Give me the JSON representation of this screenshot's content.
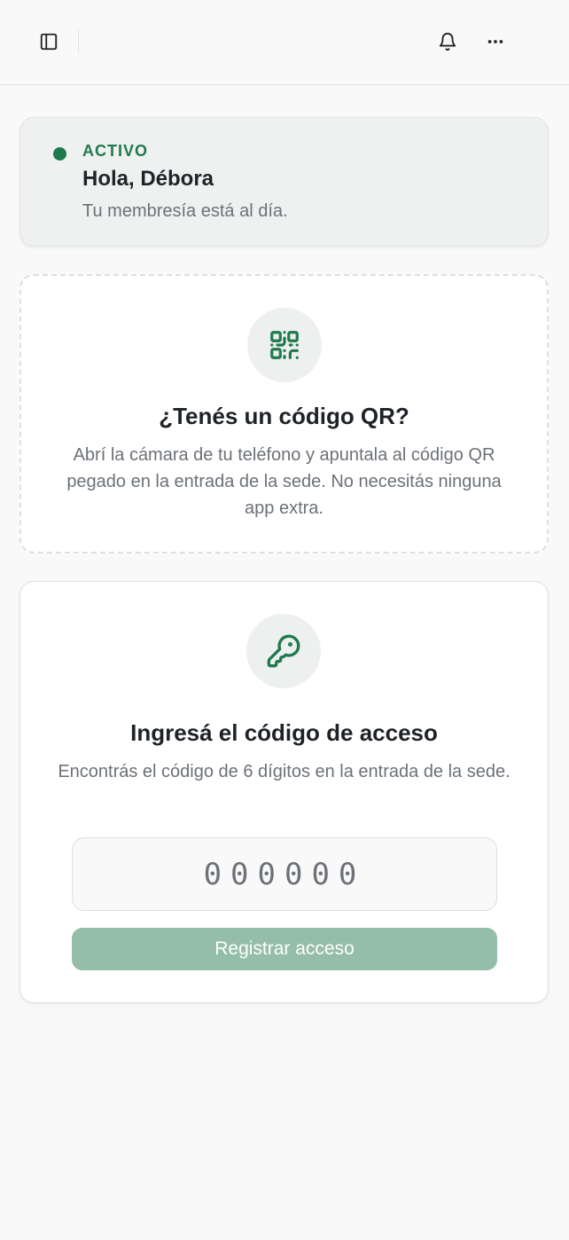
{
  "header": {
    "sidebar_icon": "sidebar-toggle-icon",
    "bell_icon": "bell-icon",
    "more_icon": "more-horizontal-icon"
  },
  "status": {
    "label": "ACTIVO",
    "greeting": "Hola, Débora",
    "description": "Tu membresía está al día.",
    "color": "#1e7a4c"
  },
  "qr": {
    "icon": "qr-code-icon",
    "title": "¿Tenés un código QR?",
    "description": "Abrí la cámara de tu teléfono y apuntala al código QR pegado en la entrada de la sede. No necesitás ninguna app extra."
  },
  "access_code": {
    "icon": "key-icon",
    "title": "Ingresá el código de acceso",
    "description": "Encontrás el código de 6 dígitos en la entrada de la sede.",
    "placeholder": "000000",
    "value": "",
    "submit_label": "Registrar acceso",
    "submit_color": "#95bea8"
  }
}
